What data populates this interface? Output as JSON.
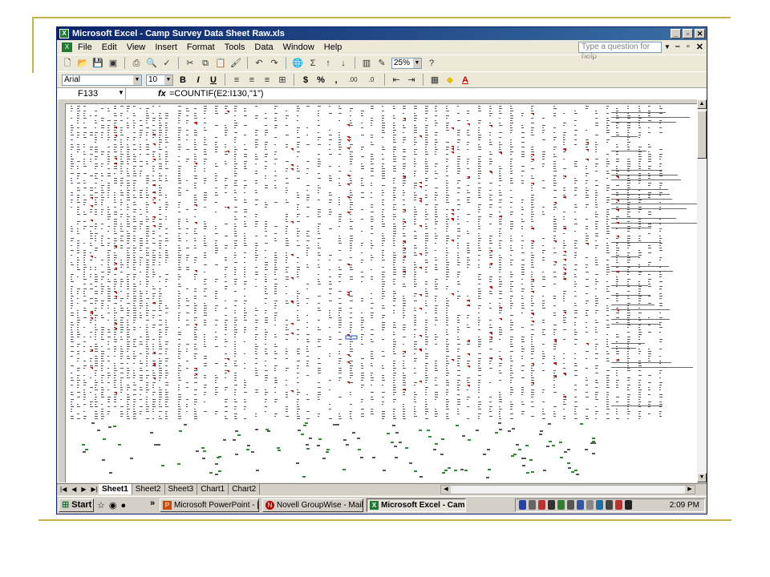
{
  "window": {
    "title": "Microsoft Excel - Camp Survey Data Sheet Raw.xls",
    "app_icon_glyph": "X",
    "controls": [
      "_",
      "▫",
      "✕"
    ]
  },
  "menubar": {
    "items": [
      "File",
      "Edit",
      "View",
      "Insert",
      "Format",
      "Tools",
      "Data",
      "Window",
      "Help"
    ],
    "help_placeholder": "Type a question for help",
    "doc_controls": [
      "–",
      "▫",
      "✕"
    ]
  },
  "toolbar": {
    "zoom": "25%",
    "font_name": "Arial",
    "font_size": "10",
    "bold": "B",
    "italic": "I",
    "underline": "U",
    "currency": "$",
    "percent": "%",
    "comma": ",",
    "inc_decimal": ".00",
    "dec_decimal": ".0"
  },
  "formula_bar": {
    "cell_ref": "F133",
    "fx": "fx",
    "formula": "=COUNTIF(E2:I130,\"1\")"
  },
  "sheets": {
    "tabs": [
      "Sheet1",
      "Sheet2",
      "Sheet3",
      "Chart1",
      "Chart2"
    ],
    "active": "Sheet1"
  },
  "taskbar": {
    "start": "Start",
    "chevron": "»",
    "tasks": [
      {
        "label": "Microsoft PowerPoint - [I...",
        "color": "#d04a02"
      },
      {
        "label": "Novell GroupWise - Mailbox",
        "color": "#c00000"
      },
      {
        "label": "Microsoft Excel - Cam...",
        "color": "#1e7b34",
        "active": true
      }
    ],
    "clock": "2:09 PM"
  },
  "colors": {
    "comment_marker": "#d40000",
    "green_marker": "#2e8b2e",
    "title_start": "#0a246a",
    "title_end": "#3a6ea5"
  }
}
